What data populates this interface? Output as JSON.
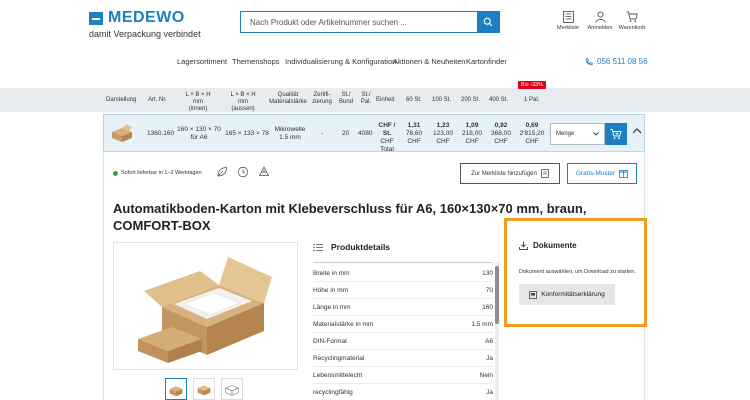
{
  "header": {
    "brand": "MEDEWO",
    "tagline": "damit Verpackung verbindet",
    "search_placeholder": "Nach Produkt oder Artikelnummer suchen ...",
    "icons": [
      {
        "label": "Merkliste",
        "icon": "list-icon"
      },
      {
        "label": "Anmelden",
        "icon": "user-icon"
      },
      {
        "label": "Warenkorb",
        "icon": "cart-icon"
      }
    ],
    "phone": "056 511 08 56"
  },
  "nav": {
    "items": [
      "Lagersortiment",
      "Themenshops",
      "Individualisierung & Konfiguration",
      "Aktionen & Neuheiten",
      "Kartonfinder"
    ]
  },
  "table_header": {
    "darstellung": "Darstellung",
    "artnr": "Art. Nr.",
    "innen_1": "L × B × H mm",
    "innen_2": "(innen)",
    "aussen_1": "L × B × H mm",
    "aussen_2": "(aussen)",
    "qual_1": "Qualität",
    "qual_2": "Materialstärke",
    "zert_1": "Zertifi-",
    "zert_2": "zierung",
    "bund_1": "St./",
    "bund_2": "Bund",
    "pal_1": "St./",
    "pal_2": "Pal.",
    "einheit": "Einheit",
    "p60": "60 St.",
    "p100": "100 St.",
    "p200": "200 St.",
    "p400": "400 St.",
    "p1pal": "1 Pal.",
    "badge": "Bis -33%"
  },
  "product_row": {
    "artnr": "1360.160",
    "innen_1": "160 × 130 × 70",
    "innen_2": "für A6",
    "aussen": "165 × 133 × 78",
    "qual_1": "Mikrowelle",
    "qual_2": "1.5 mm",
    "zert": "-",
    "bund": "20",
    "pal": "4080",
    "einheit_1": "CHF / St.",
    "einheit_2": "CHF",
    "einheit_3": "Total",
    "prices": [
      {
        "unit": "1,31",
        "total": "78,60",
        "cur": "CHF"
      },
      {
        "unit": "1,23",
        "total": "123,00",
        "cur": "CHF"
      },
      {
        "unit": "1,09",
        "total": "218,00",
        "cur": "CHF"
      },
      {
        "unit": "0,92",
        "total": "368,00",
        "cur": "CHF"
      },
      {
        "unit": "0,69",
        "total": "2'815,20",
        "cur": "CHF"
      }
    ],
    "qty_label": "Menge"
  },
  "product": {
    "availability": "Sofort lieferbar in 1–2 Werktagen",
    "merkliste_button": "Zur Merkliste hinzufügen",
    "muster_button": "Gratis-Muster",
    "title": "Automatikboden-Karton mit Klebeverschluss für A6, 160×130×70 mm, braun, COMFORT-BOX"
  },
  "details": {
    "heading": "Produktdetails",
    "rows": [
      {
        "label": "Breite in mm",
        "value": "130"
      },
      {
        "label": "Höhe in mm",
        "value": "70"
      },
      {
        "label": "Länge in mm",
        "value": "160"
      },
      {
        "label": "Materialstärke in mm",
        "value": "1.5 mm"
      },
      {
        "label": "DIN-Format",
        "value": "A6"
      },
      {
        "label": "Recyclingmaterial",
        "value": "Ja"
      },
      {
        "label": "Lebensmittelecht",
        "value": "Nein"
      },
      {
        "label": "recyclingfähig",
        "value": "Ja"
      }
    ]
  },
  "documents": {
    "heading": "Dokumente",
    "text": "Dokument auswählen, um Download zu starten.",
    "button": "Konformitätserklärung"
  },
  "colors": {
    "brand": "#1a80c4",
    "highlight": "#f39c1f",
    "badge": "#e2001a",
    "available": "#2fa84f"
  }
}
